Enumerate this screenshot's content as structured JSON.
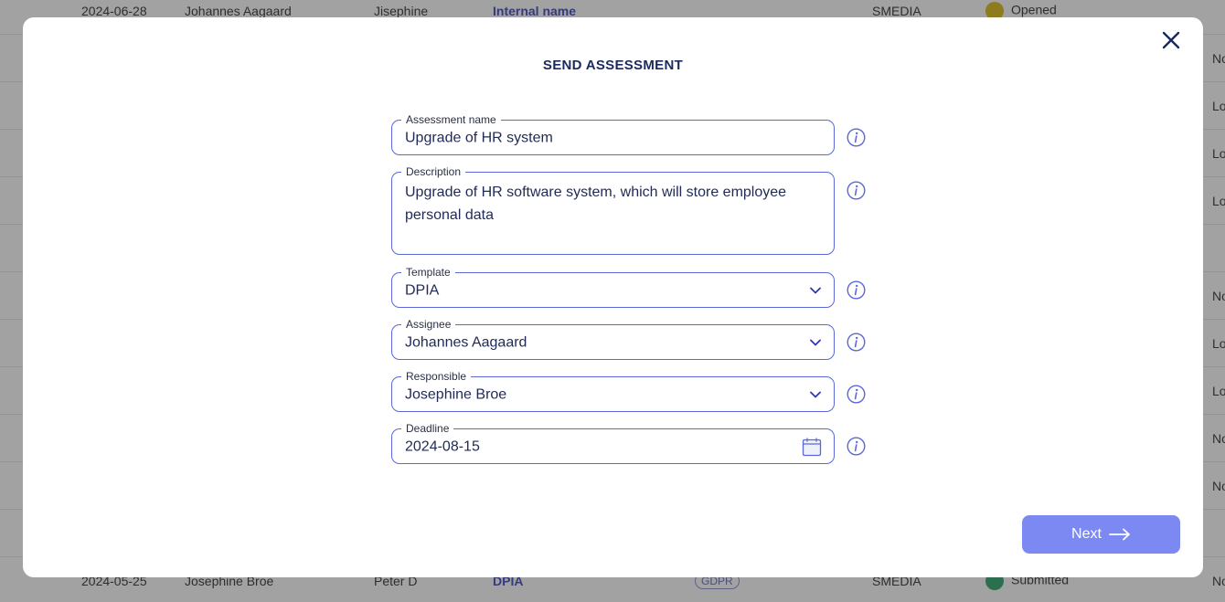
{
  "background_table": {
    "top_row": {
      "date": "2024-06-28",
      "assignee": "Johannes Aagaard",
      "responsible": "Jisephine",
      "name": "Internal name",
      "org": "SMEDIA",
      "status": "Opened"
    },
    "bottom_row": {
      "date": "2024-05-25",
      "assignee": "Josephine Broe",
      "responsible": "Peter D",
      "name": "DPIA",
      "tag": "GDPR",
      "org": "SMEDIA",
      "status": "Submitted"
    },
    "right_edge_cells": [
      "No",
      "Lo",
      "Lo",
      "Lo",
      "No",
      "Lo",
      "Lo",
      "No",
      "No",
      "No"
    ]
  },
  "modal": {
    "title": "SEND ASSESSMENT",
    "fields": {
      "assessment_name": {
        "label": "Assessment name",
        "value": "Upgrade of HR system"
      },
      "description": {
        "label": "Description",
        "value": "Upgrade of HR software system, which will store employee personal data"
      },
      "template": {
        "label": "Template",
        "value": "DPIA"
      },
      "assignee": {
        "label": "Assignee",
        "value": "Johannes Aagaard"
      },
      "responsible": {
        "label": "Responsible",
        "value": "Josephine Broe"
      },
      "deadline": {
        "label": "Deadline",
        "value": "2024-08-15"
      }
    },
    "next_label": "Next",
    "icons": {
      "close": "close-icon",
      "info": "info-icon",
      "chevron": "chevron-down-icon",
      "calendar": "calendar-icon",
      "arrow": "arrow-right-icon"
    }
  },
  "colors": {
    "accent": "#5c68d8",
    "title": "#1b2a5e",
    "next_button": "#7c89f3",
    "status_opened": "#d9b400",
    "status_submitted": "#1e9e62"
  }
}
